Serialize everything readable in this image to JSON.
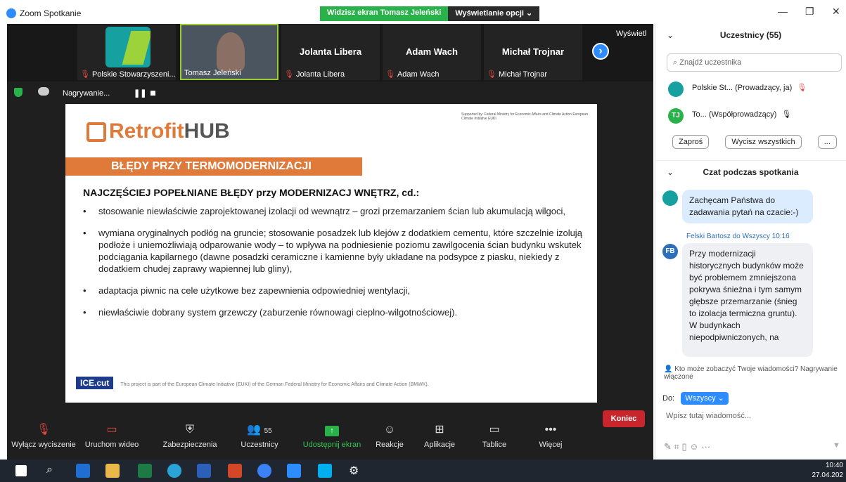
{
  "window": {
    "title": "Zoom Spotkanie",
    "share_status": "Widzisz ekran Tomasz Jeleński",
    "view_options": "Wyświetlanie opcji"
  },
  "gallery": {
    "tiles": [
      {
        "caption": "Polskie Stowarzyszeni...",
        "name": ""
      },
      {
        "caption": "Tomasz Jeleński",
        "name": ""
      },
      {
        "caption": "Jolanta Libera",
        "name": "Jolanta Libera"
      },
      {
        "caption": "Adam Wach",
        "name": "Adam Wach"
      },
      {
        "caption": "Michał Trojnar",
        "name": "Michał Trojnar"
      }
    ],
    "overflow_label": "Wyświetl"
  },
  "recording": {
    "label": "Nagrywanie..."
  },
  "slide": {
    "logo_text": "Retrofit",
    "logo_hub": "HUB",
    "banner": "BŁĘDY PRZY TERMOMODERNIZACJI",
    "heading": "NAJCZĘŚCIEJ POPEŁNIANE BŁĘDY przy MODERNIZACJ WNĘTRZ, cd.:",
    "bullets": [
      "stosowanie niewłaściwie zaprojektowanej izolacji od wewnątrz – grozi przemarzaniem ścian lub akumulacją wilgoci,",
      "wymiana oryginalnych podłóg na gruncie; stosowanie posadzek lub klejów z dodatkiem cementu, które szczelnie izolują podłoże i uniemożliwiają odparowanie wody – to wpływa na podniesienie poziomu zawilgocenia ścian budynku wskutek podciągania kapilarnego (dawne posadzki ceramiczne i kamienne były układane na podsypce z piasku, niekiedy z dodatkiem chudej zaprawy wapiennej lub gliny),",
      "adaptacja piwnic na cele użytkowe bez zapewnienia odpowiedniej wentylacji,",
      "niewłaściwie dobrany system grzewczy (zaburzenie równowagi cieplno-wilgotnościowej)."
    ],
    "support": "Supported by: Federal Ministry for Economic Affairs and Climate Action   European Climate Initiative EUKI",
    "footer_logo": "ICE.cut",
    "footer_text": "This project is part of the European Climate Initiative (EUKI) of the German Federal Ministry for Economic Affairs and Climate Action (BMWK)."
  },
  "toolbar": {
    "items": [
      {
        "label": "Wyłącz wyciszenie",
        "icon": "mic-muted-icon"
      },
      {
        "label": "Uruchom wideo",
        "icon": "video-off-icon"
      },
      {
        "label": "Zabezpieczenia",
        "icon": "shield-icon"
      },
      {
        "label": "Uczestnicy",
        "icon": "participants-icon",
        "count": "55"
      },
      {
        "label": "Udostępnij ekran",
        "icon": "share-screen-icon"
      },
      {
        "label": "Reakcje",
        "icon": "reactions-icon"
      },
      {
        "label": "Aplikacje",
        "icon": "apps-icon"
      },
      {
        "label": "Tablice",
        "icon": "whiteboard-icon"
      },
      {
        "label": "Więcej",
        "icon": "more-icon"
      }
    ],
    "end": "Koniec"
  },
  "participants": {
    "title": "Uczestnicy (55)",
    "search_placeholder": "Znajdź uczestnika",
    "rows": [
      {
        "name": "Polskie St...",
        "role": "(Prowadzący, ja)",
        "initials": ""
      },
      {
        "name": "To...",
        "role": "(Współprowadzący)",
        "initials": "TJ"
      }
    ],
    "invite": "Zaproś",
    "mute_all": "Wycisz wszystkich",
    "more": "..."
  },
  "chat": {
    "title": "Czat podczas spotkania",
    "messages": [
      {
        "sender": "",
        "text": "Zachęcam Państwa do zadawania pytań na czacie:-)"
      },
      {
        "sender": "Felski Bartosz do Wszyscy 10:16",
        "initials": "FB",
        "text": "Przy modernizacji historycznych budynków może być problemem zmniejszona pokrywa śnieżna i tym samym głębsze przemarzanie (śnieg to izolacja termiczna gruntu). W budynkach niepodpiwniczonych, na"
      }
    ],
    "visibility": "Kto może zobaczyć Twoje wiadomości? Nagrywanie włączone",
    "to_label": "Do:",
    "to_value": "Wszyscy",
    "input_placeholder": "Wpisz tutaj wiadomość..."
  },
  "taskbar": {
    "time": "10:40",
    "date": "27.04.202"
  }
}
